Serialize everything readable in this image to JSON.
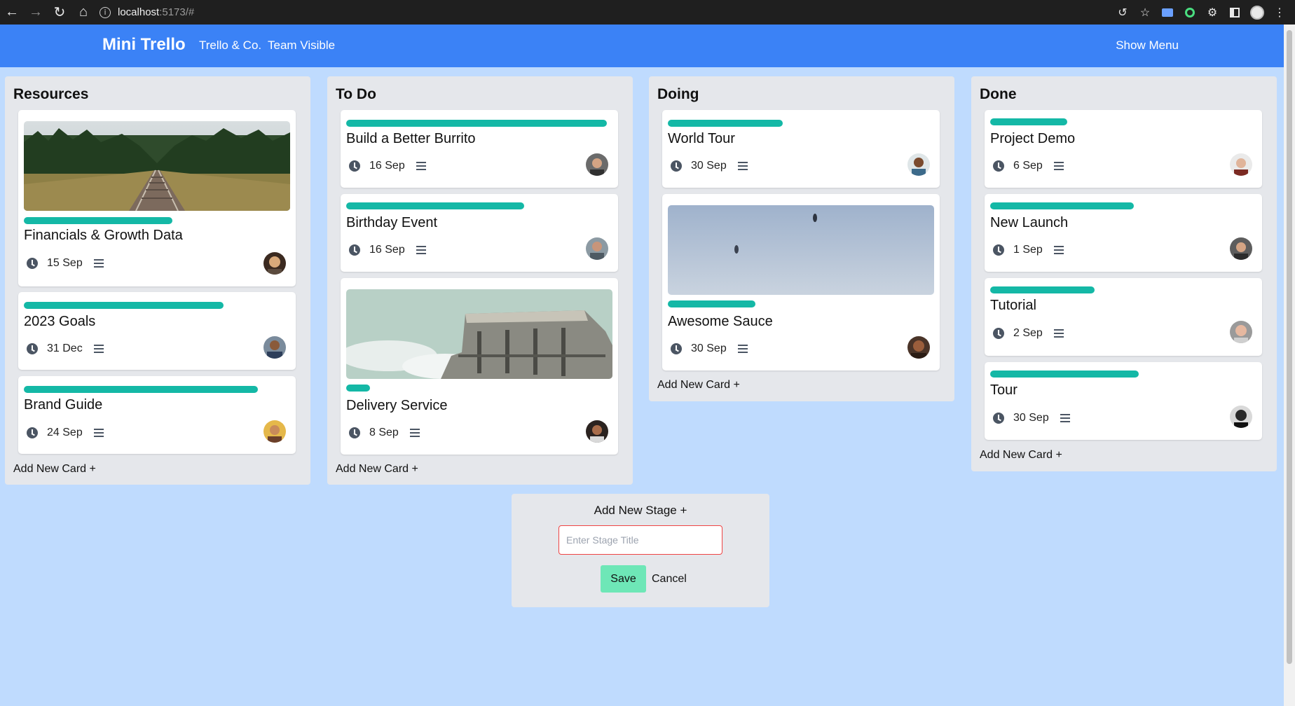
{
  "browser": {
    "url_host": "localhost",
    "url_rest": ":5173/#",
    "icons": [
      "back-icon",
      "forward-icon",
      "reload-icon",
      "home-icon",
      "site-info-icon",
      "share-icon",
      "star-icon",
      "extension-icon",
      "puzzle-icon",
      "sidebar-icon",
      "profile-avatar",
      "more-icon"
    ]
  },
  "header": {
    "brand": "Mini Trello",
    "workspace": "Trello & Co.",
    "visibility": "Team Visible",
    "menu_label": "Show Menu",
    "background": "#3b82f6"
  },
  "accent_colors": {
    "label_bar": "#14b8a6",
    "save_button": "#6ee7b7",
    "input_error_border": "#ef4444",
    "board_bg": "#bfdbfe",
    "column_bg": "#e5e7eb"
  },
  "columns": [
    {
      "title": "Resources",
      "add_label": "Add New Card +",
      "cards": [
        {
          "title": "Financials & Growth Data",
          "date": "15 Sep",
          "cover": "rail-tracks-forest-photo",
          "label_fraction": 0.47
        },
        {
          "title": "2023 Goals",
          "date": "31 Dec",
          "label_fraction": 0.63
        },
        {
          "title": "Brand Guide",
          "date": "24 Sep",
          "label_fraction": 0.74
        }
      ]
    },
    {
      "title": "To Do",
      "add_label": "Add New Card +",
      "cards": [
        {
          "title": "Build a Better Burrito",
          "date": "16 Sep",
          "label_fraction": 0.82
        },
        {
          "title": "Birthday Event",
          "date": "16 Sep",
          "label_fraction": 0.56
        },
        {
          "title": "Delivery Service",
          "date": "8 Sep",
          "cover": "concrete-building-photo",
          "label_fraction": 0.08
        }
      ]
    },
    {
      "title": "Doing",
      "add_label": "Add New Card +",
      "cards": [
        {
          "title": "World Tour",
          "date": "30 Sep",
          "label_fraction": 0.36
        },
        {
          "title": "Awesome Sauce",
          "date": "30 Sep",
          "cover": "sky-birds-photo",
          "label_fraction": 0.28
        }
      ]
    },
    {
      "title": "Done",
      "add_label": "Add New Card +",
      "cards": [
        {
          "title": "Project Demo",
          "date": "6 Sep",
          "label_fraction": 0.26
        },
        {
          "title": "New Launch",
          "date": "1 Sep",
          "label_fraction": 0.45
        },
        {
          "title": "Tutorial",
          "date": "2 Sep",
          "label_fraction": 0.33
        },
        {
          "title": "Tour",
          "date": "30 Sep",
          "label_fraction": 0.47
        }
      ]
    }
  ],
  "new_stage": {
    "title": "Add New Stage +",
    "placeholder": "Enter Stage Title",
    "save_label": "Save",
    "cancel_label": "Cancel"
  }
}
